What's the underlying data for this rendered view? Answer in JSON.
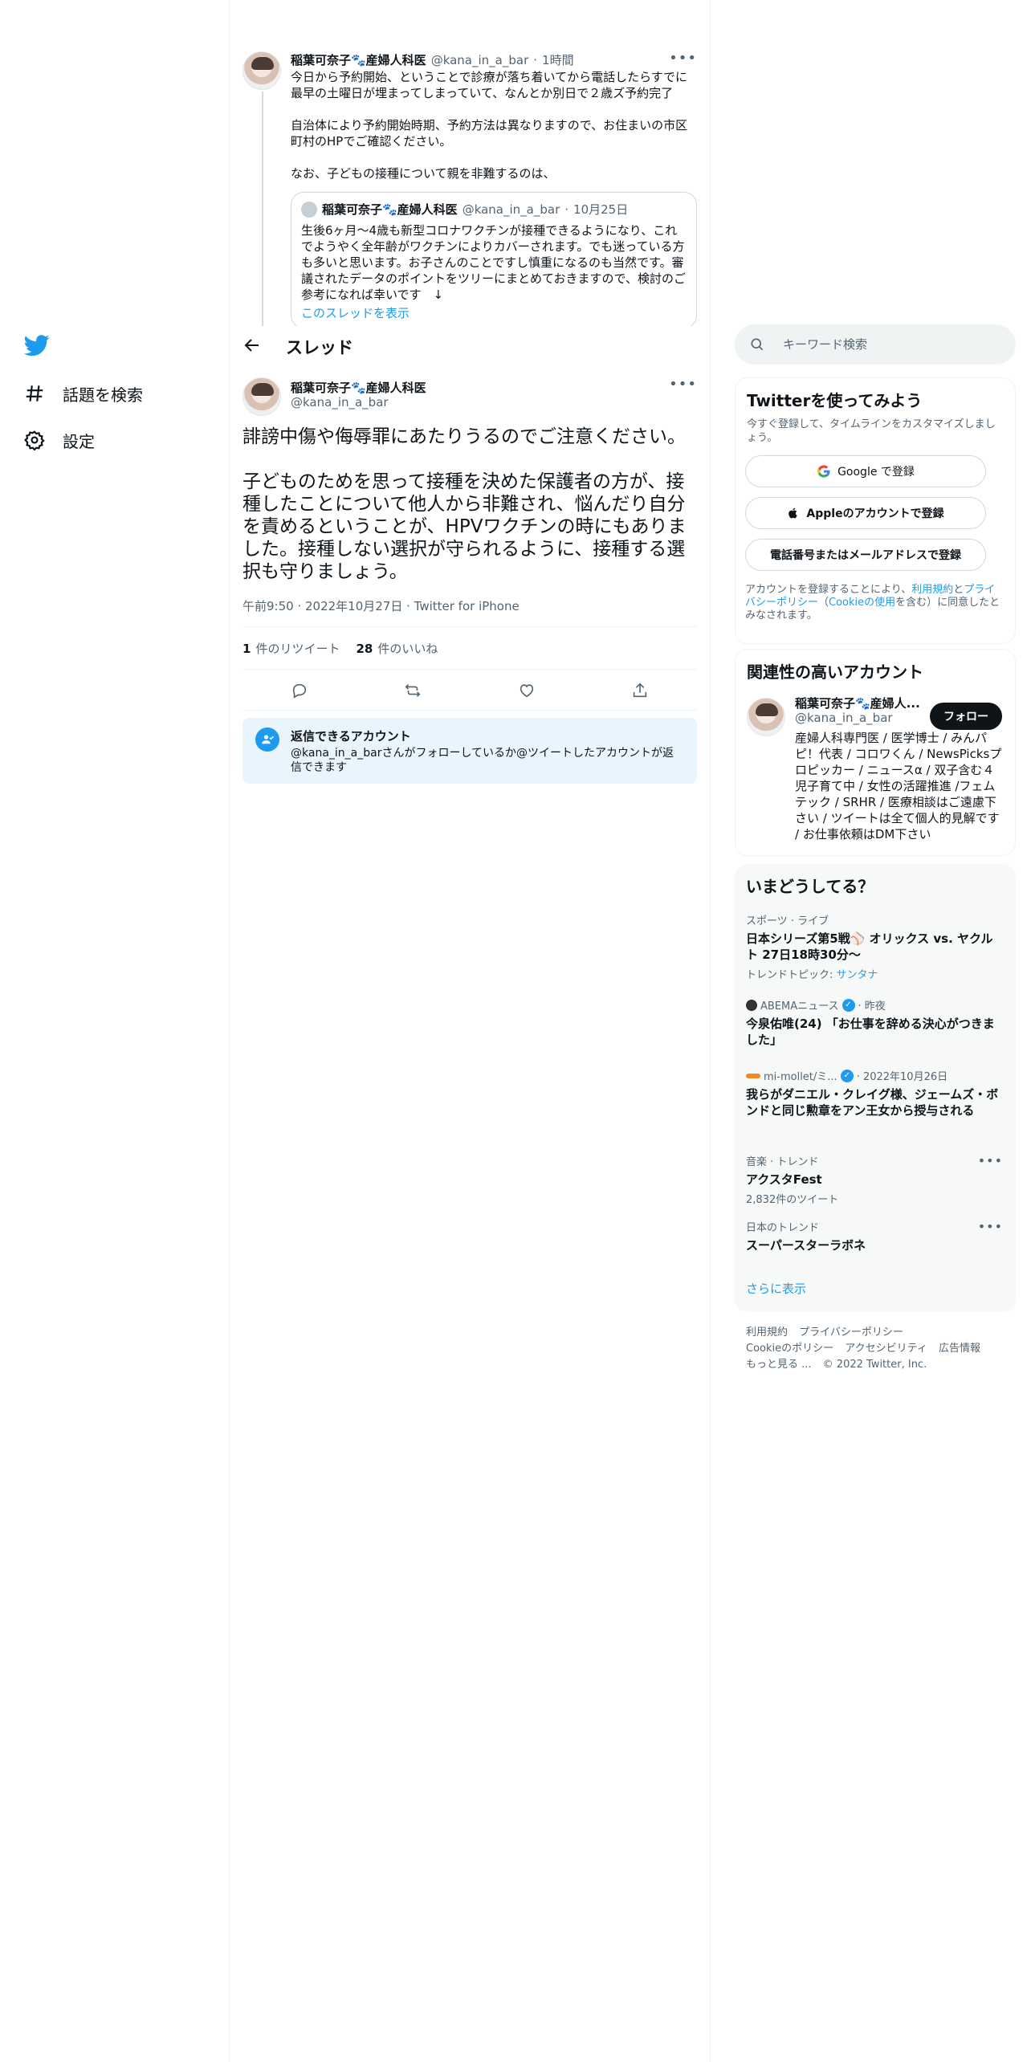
{
  "nav": {
    "items": [
      {
        "label": "話題を検索",
        "icon": "hashtag-icon"
      },
      {
        "label": "設定",
        "icon": "gear-icon"
      }
    ]
  },
  "previous_tweet": {
    "name": "稲葉可奈子🐾産婦人科医",
    "handle": "@kana_in_a_bar",
    "time": "1時間",
    "paragraphs": [
      "今日から予約開始、ということで診療が落ち着いてから電話したらすでに最早の土曜日が埋まってしまっていて、なんとか別日で２歳ズ予約完了",
      "自治体により予約開始時期、予約方法は異なりますので、お住まいの市区町村のHPでご確認ください。",
      "なお、子どもの接種について親を非難するのは、"
    ],
    "quote": {
      "name": "稲葉可奈子🐾産婦人科医",
      "handle": "@kana_in_a_bar",
      "time": "10月25日",
      "text": "生後6ヶ月～4歳も新型コロナワクチンが接種できるようになり、これでようやく全年齢がワクチンによりカバーされます。でも迷っている方も多いと思います。お子さんのことですし慎重になるのも当然です。審議されたデータのポイントをツリーにまとめておきますので、検討のご参考になれば幸いです　↓",
      "link": "このスレッドを表示"
    }
  },
  "header": {
    "title": "スレッド"
  },
  "main_tweet": {
    "name": "稲葉可奈子🐾産婦人科医",
    "handle": "@kana_in_a_bar",
    "paragraphs": [
      "誹謗中傷や侮辱罪にあたりうるのでご注意ください。",
      "子どものためを思って接種を決めた保護者の方が、接種したことについて他人から非難され、悩んだり自分を責めるということが、HPVワクチンの時にもありました。接種しない選択が守られるように、接種する選択も守りましょう。"
    ],
    "meta": "午前9:50 · 2022年10月27日 · Twitter for iPhone",
    "retweets": "1",
    "retweets_label": "件のリツイート",
    "likes": "28",
    "likes_label": "件のいいね"
  },
  "reply_notice": {
    "title": "返信できるアカウント",
    "desc": "@kana_in_a_barさんがフォローしているか@ツイートしたアカウントが返信できます"
  },
  "search": {
    "placeholder": "キーワード検索"
  },
  "signup": {
    "title": "Twitterを使ってみよう",
    "subtitle": "今すぐ登録して、タイムラインをカスタマイズしましょう。",
    "google_label": "Google で登録",
    "apple_label": "Appleのアカウントで登録",
    "phone_label": "電話番号またはメールアドレスで登録",
    "legal_prefix": "アカウントを登録することにより、",
    "legal_terms": "利用規約",
    "legal_and": "と",
    "legal_privacy": "プライバシーポリシー",
    "legal_paren_open": "（",
    "legal_cookie": "Cookieの使用",
    "legal_suffix": "を含む）に同意したとみなされます。"
  },
  "relevant": {
    "title": "関連性の高いアカウント",
    "name": "稲葉可奈子🐾産婦人...",
    "handle": "@kana_in_a_bar",
    "follow_label": "フォロー",
    "bio": "産婦人科専門医 / 医学博士 / みんパピ！代表 / コロワくん / NewsPicksプロピッカー / ニュースα / 双子含む４児子育て中 / 女性の活躍推進 /フェムテック / SRHR / 医療相談はご遠慮下さい / ツイートは全て個人的見解です / お仕事依頼はDM下さい"
  },
  "trends": {
    "title": "いまどうしてる？",
    "items": [
      {
        "context": "スポーツ · ライブ",
        "title": "日本シリーズ第5戦⚾ オリックス vs. ヤクルト 27日18時30分〜",
        "sub_prefix": "トレンドトピック: ",
        "sub_link": "サンタナ"
      },
      {
        "context_source": "ABEMAニュース",
        "context_time": "· 昨夜",
        "title": "今泉佑唯(24) 「お仕事を辞める決心がつきました」"
      },
      {
        "context_source": "mi-mollet/ミ...",
        "context_time": "· 2022年10月26日",
        "title": "我らがダニエル・クレイグ様、ジェームズ・ボンドと同じ勲章をアン王女から授与される"
      },
      {
        "context": "音楽 · トレンド",
        "title": "アクスタFest",
        "sub": "2,832件のツイート"
      },
      {
        "context": "日本のトレンド",
        "title": "スーパースターラボネ"
      }
    ],
    "show_more": "さらに表示"
  },
  "footer": {
    "links": [
      "利用規約",
      "プライバシーポリシー",
      "Cookieのポリシー",
      "アクセシビリティ",
      "広告情報",
      "もっと見る ..."
    ],
    "copyright": "© 2022 Twitter, Inc."
  },
  "colors": {
    "accent": "#1d9bf0",
    "text": "#0f1419",
    "muted": "#536471",
    "border": "#eff3f4"
  }
}
